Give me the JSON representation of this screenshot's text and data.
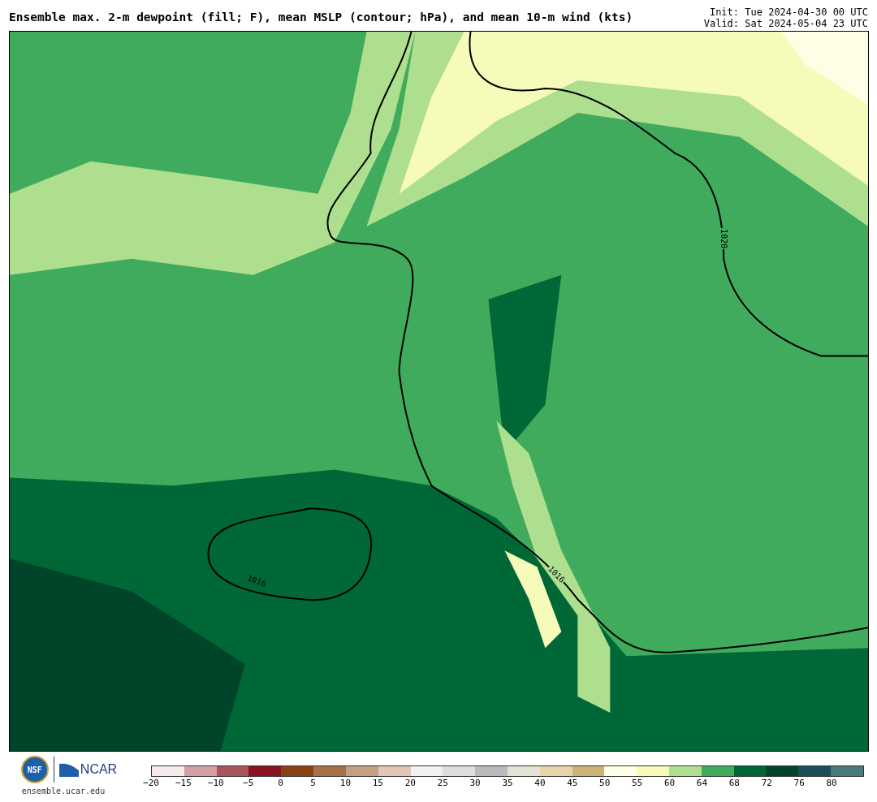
{
  "title": "Ensemble max. 2-m dewpoint (fill; F), mean MSLP (contour; hPa), and mean 10-m wind (kts)",
  "init": "Init: Tue 2024-04-30 00 UTC",
  "valid": "Valid: Sat 2024-05-04 23 UTC",
  "map": {
    "contour_labels": [
      "1020",
      "1016",
      "1016"
    ]
  },
  "footer": {
    "logo_left": "NSF",
    "logo_right": "NCAR",
    "site": "ensemble.ucar.edu"
  },
  "colorbar": {
    "swatches": [
      {
        "color": "#f5eaea"
      },
      {
        "color": "#d4a0a4"
      },
      {
        "color": "#a8545a"
      },
      {
        "color": "#8b1320"
      },
      {
        "color": "#8a4113"
      },
      {
        "color": "#a8714c"
      },
      {
        "color": "#c59f82"
      },
      {
        "color": "#e1c6b5"
      },
      {
        "color": "#f2f2f2"
      },
      {
        "color": "#dedede"
      },
      {
        "color": "#bababa"
      },
      {
        "color": "#e2e3d4"
      },
      {
        "color": "#e6d5a8"
      },
      {
        "color": "#cdb475"
      },
      {
        "color": "#fefee6"
      },
      {
        "color": "#f7fbb9"
      },
      {
        "color": "#addf8e"
      },
      {
        "color": "#41ab5d"
      },
      {
        "color": "#006837"
      },
      {
        "color": "#004529"
      },
      {
        "color": "#1a4f57"
      },
      {
        "color": "#4a7a7a"
      }
    ],
    "ticks": [
      "−20",
      "−15",
      "−10",
      "−5",
      "0",
      "5",
      "10",
      "15",
      "20",
      "25",
      "30",
      "35",
      "40",
      "45",
      "50",
      "55",
      "60",
      "64",
      "68",
      "72",
      "76",
      "80"
    ]
  }
}
